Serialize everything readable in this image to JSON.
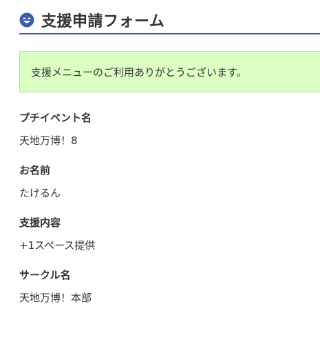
{
  "header": {
    "icon": "smile-icon",
    "icon_color": "#3f5dab",
    "title": "支援申請フォーム"
  },
  "notice": {
    "message": "支援メニューのご利用ありがとうございます。",
    "background": "#dcffc4"
  },
  "fields": [
    {
      "label": "プチイベント名",
      "value": "天地万博！8"
    },
    {
      "label": "お名前",
      "value": "たけるん"
    },
    {
      "label": "支援内容",
      "value": "+1スペース提供"
    },
    {
      "label": "サークル名",
      "value": "天地万博！本部"
    }
  ]
}
